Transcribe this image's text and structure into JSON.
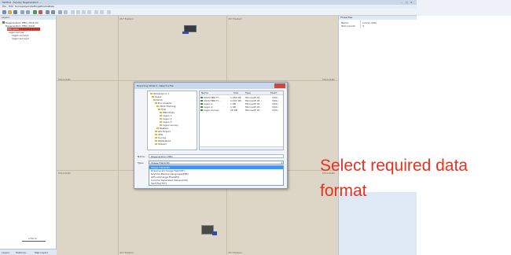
{
  "window": {
    "title": "TerMod - Survey: Regeneration ...",
    "controls": [
      "–",
      "□",
      "✕"
    ]
  },
  "menu": [
    "File",
    "Edit",
    "Survey",
    "Layers",
    "Settings",
    "Window",
    "Help"
  ],
  "left_panel": {
    "header": "Layers",
    "tree": [
      "Regeneration HBO_2016-03",
      "Regeneration HBO_2016",
      "HBO plots",
      "regen survey",
      "regen survey1",
      "regen survey2"
    ],
    "tabs": [
      "Layers",
      "Features",
      "Map Layers"
    ],
    "scale": "1:50 m"
  },
  "map": {
    "coord_top_1": "457 Eastern",
    "coord_top_2": "457 Eastern",
    "coord_left_1": "5511244N",
    "coord_right_1": "5511244N",
    "coord_left_2": "5511244N",
    "coord_right_2": "5511244N",
    "coord_bottom_1": "457 Eastern",
    "coord_bottom_2": "457 Eastern"
  },
  "right_panel": {
    "header": "Properties",
    "rows": [
      {
        "label": "Name",
        "value": "survey data"
      },
      {
        "label": "Item counts",
        "value": "4"
      }
    ]
  },
  "dialog": {
    "title": "Exporting Wizard - Select a File",
    "folders": [
      "Windows (C:)",
      "Users",
      "bbrill",
      "Documents",
      "2016 Training",
      "Trial",
      "HBO Plots",
      "regen 1",
      "regen 2",
      "regen 3",
      "regen survey",
      "Rasters",
      "GIS Export",
      "XML",
      "Survey",
      "Watershed",
      "Shared"
    ],
    "file_columns": [
      "Name",
      "Size",
      "Type",
      "Modif"
    ],
    "files": [
      {
        "name": "2016 HBO Fl...",
        "size": "1,050 KB",
        "type": "Microsoft Of...",
        "mod": "3/01/"
      },
      {
        "name": "2016 HBO Fl...",
        "size": "1,107 KB",
        "type": "Microsoft Of...",
        "mod": "3/01/"
      },
      {
        "name": "regen 1",
        "size": "1 KB",
        "type": "Microsoft Of...",
        "mod": "3/01/"
      },
      {
        "name": "regen 2",
        "size": "1 KB",
        "type": "Microsoft Of...",
        "mod": "3/01/"
      },
      {
        "name": "regen survey",
        "size": "16 KB",
        "type": "Microsoft Of...",
        "mod": "3/01/"
      }
    ],
    "name_label": "Name:",
    "name_value": "Regeneration HBO",
    "type_label": "Type:",
    "type_value": "Shape File(SHP)",
    "type_options": [
      "Shape File(SHP)",
      "Drawing eXchange File(DXF)",
      "Keyhole Markup Language(KML)",
      "GPS eXchange File(GPX)",
      "Comma Separated Values(CSV)",
      "Text File(TXT)"
    ]
  },
  "annotation": {
    "line1": "Select required data",
    "line2": "format",
    "color": "#e8321e"
  },
  "colors": {
    "map_bg": "#ddd5c6",
    "selection": "#3399ff",
    "dialog_title": "#c9d7ea",
    "close_red": "#c84a3c"
  }
}
